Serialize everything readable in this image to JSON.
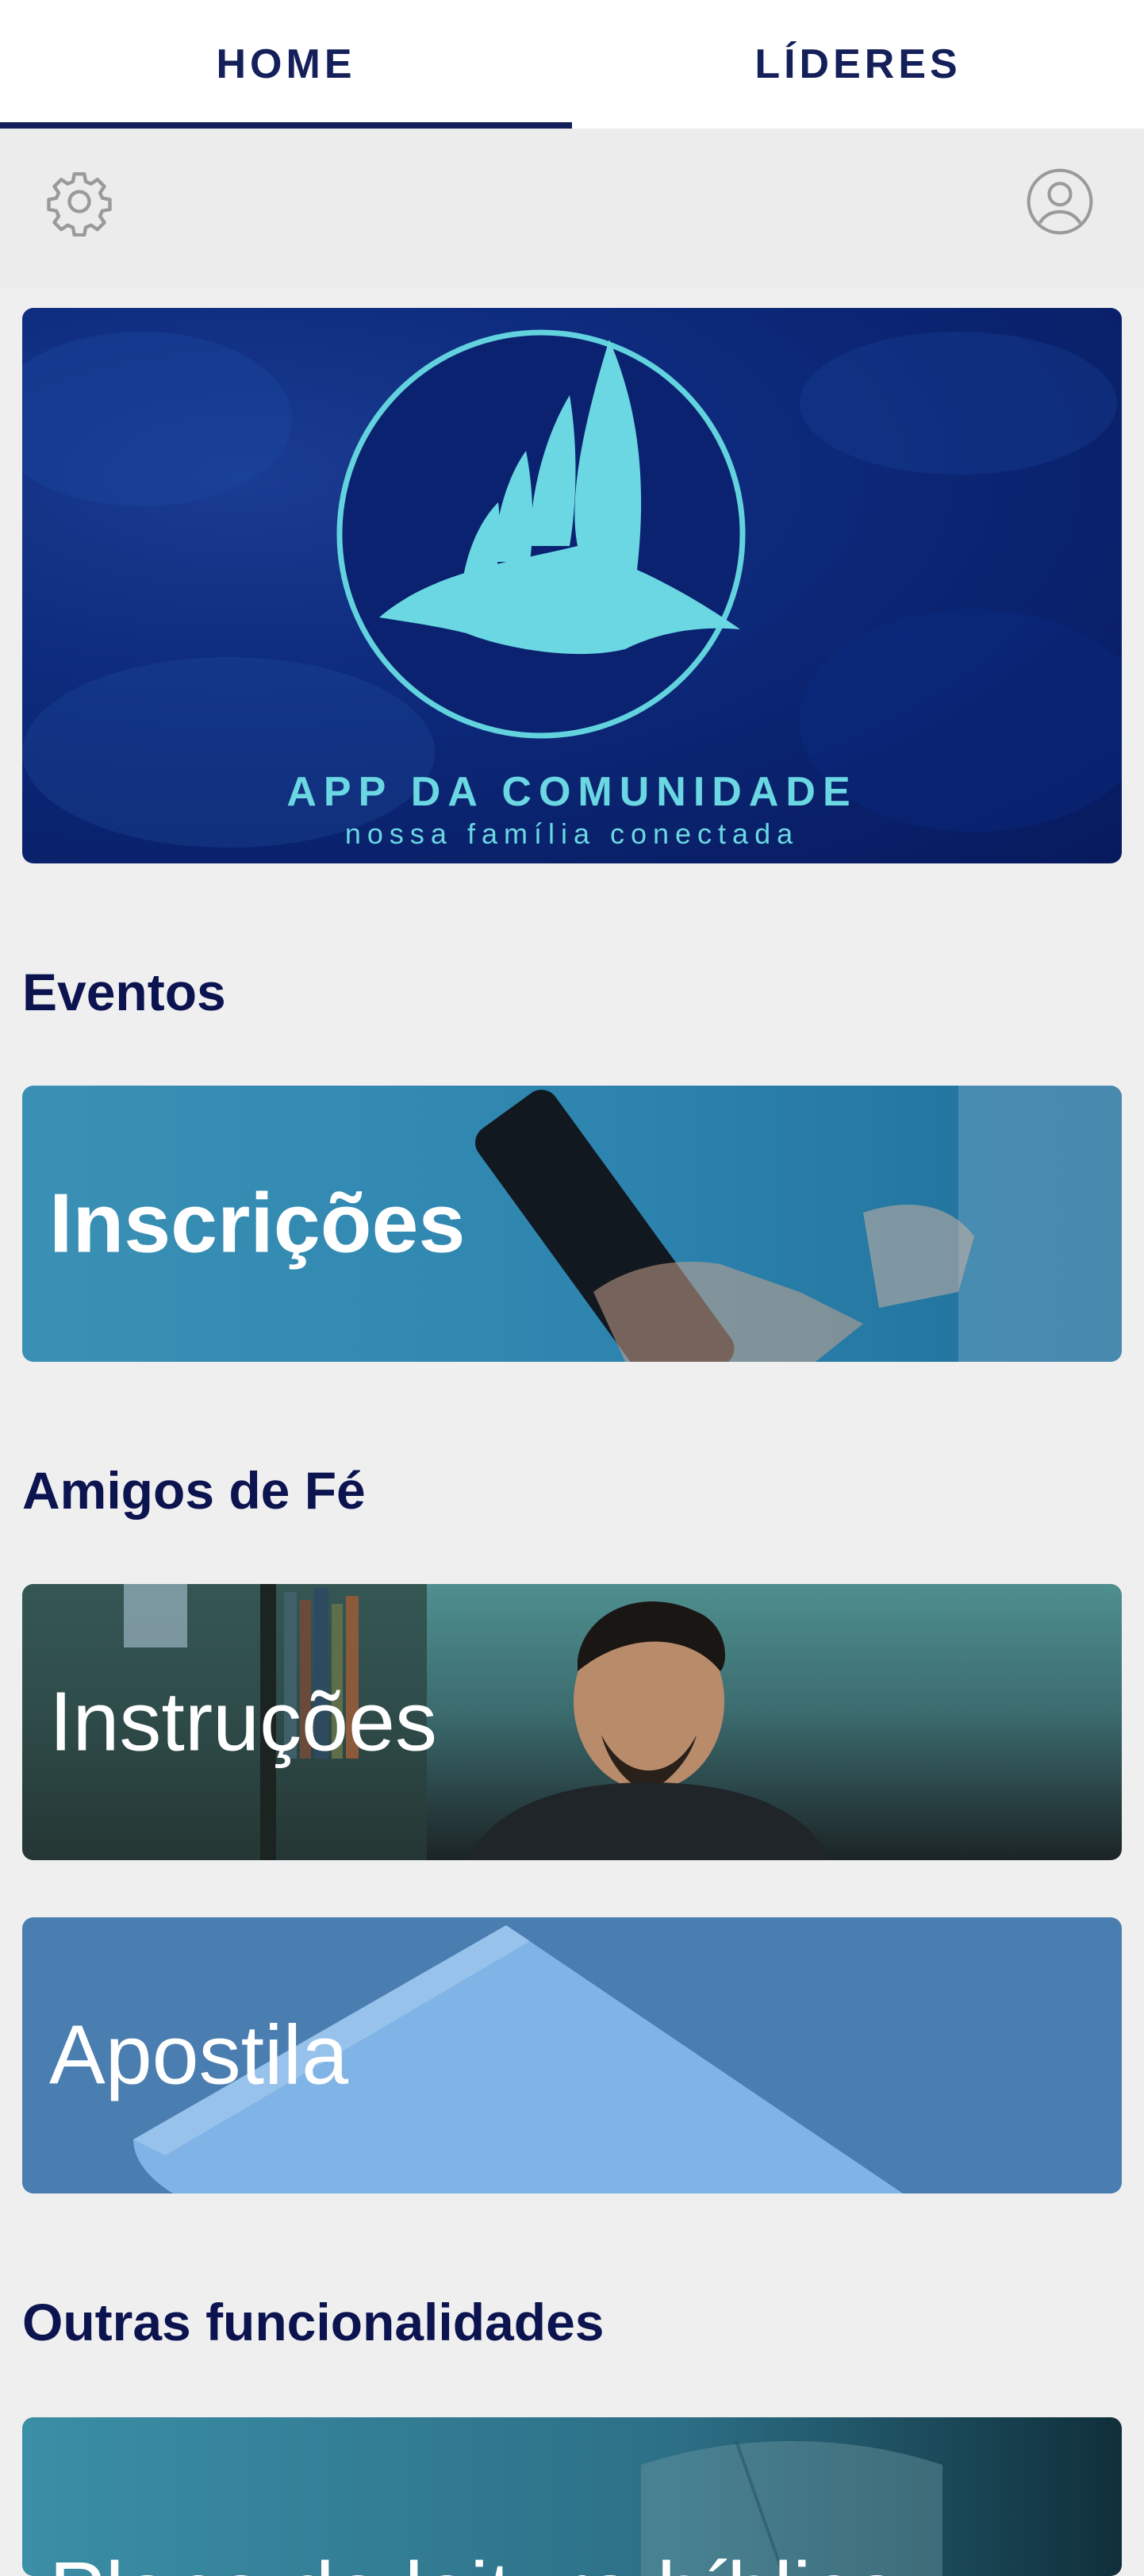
{
  "tabs": [
    {
      "label": "HOME",
      "active": true
    },
    {
      "label": "LÍDERES",
      "active": false
    }
  ],
  "toolbar": {
    "left_icon": "gear-icon",
    "right_icon": "user-circle-icon"
  },
  "banner": {
    "title": "APP DA COMUNIDADE",
    "subtitle": "nossa família conectada",
    "logo_icon": "dove-icon"
  },
  "sections": {
    "eventos": {
      "title": "Eventos",
      "cards": [
        {
          "label": "Inscrições"
        }
      ]
    },
    "amigos": {
      "title": "Amigos de Fé",
      "cards": [
        {
          "label": "Instruções"
        },
        {
          "label": "Apostila"
        }
      ]
    },
    "outras": {
      "title": "Outras funcionalidades",
      "cards": [
        {
          "label": "Plano de leitura bíblica"
        }
      ]
    }
  },
  "colors": {
    "primary": "#15205a",
    "accent": "#6ad7e2",
    "background": "#f0eff0"
  }
}
